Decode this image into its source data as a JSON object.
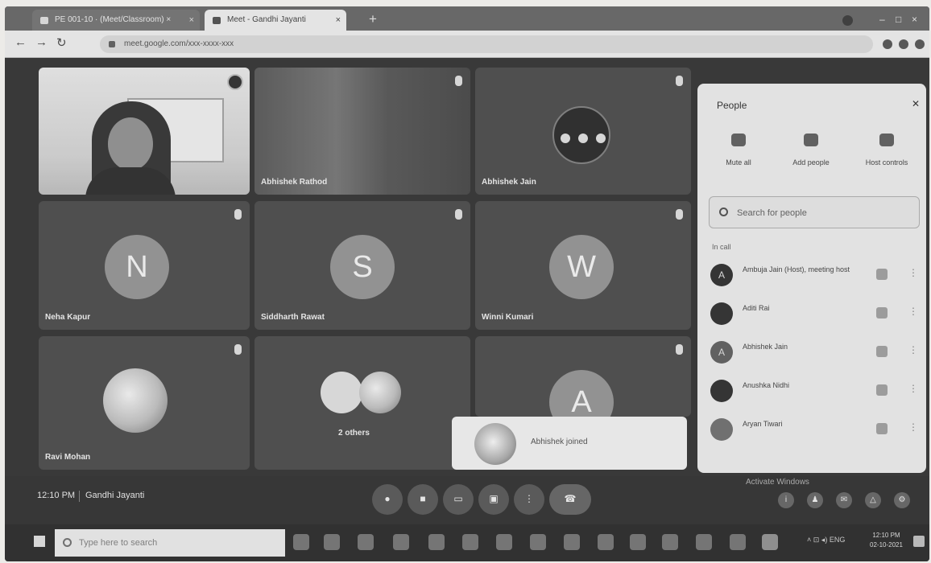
{
  "browser": {
    "tabs": [
      {
        "label": "PE 001-10 · (Meet/Classroom) ×"
      },
      {
        "label": "Meet - Gandhi Jayanti"
      }
    ],
    "new_tab_glyph": "+",
    "url": "meet.google.com/xxx-xxxx-xxx"
  },
  "meet": {
    "tiles": [
      {
        "name": "",
        "type": "video"
      },
      {
        "name": "Abhishek Rathod",
        "type": "blur"
      },
      {
        "name": "Abhishek Jain",
        "type": "self-controls"
      },
      {
        "name": "Neha Kapur",
        "type": "letter",
        "initial": "N"
      },
      {
        "name": "Siddharth Rawat",
        "type": "letter",
        "initial": "S"
      },
      {
        "name": "Winni Kumari",
        "type": "letter",
        "initial": "W"
      },
      {
        "name": "Ravi Mohan",
        "type": "picture"
      },
      {
        "name": "2 others",
        "type": "multi"
      },
      {
        "name": "",
        "type": "letter",
        "initial": "A"
      }
    ],
    "toast": "Abhishek joined"
  },
  "people": {
    "title": "People",
    "actions": [
      {
        "label": "Mute all",
        "icon": "mic-off-icon"
      },
      {
        "label": "Add people",
        "icon": "add-person-icon"
      },
      {
        "label": "Host controls",
        "icon": "shield-icon"
      }
    ],
    "search_placeholder": "Search for people",
    "section": "In call",
    "participants": [
      {
        "initial": "A",
        "name": "Ambuja Jain (Host), meeting host"
      },
      {
        "initial": "",
        "name": "Aditi Rai"
      },
      {
        "initial": "A",
        "name": "Abhishek Jain"
      },
      {
        "initial": "",
        "name": "Anushka Nidhi"
      },
      {
        "initial": "",
        "name": "Aryan Tiwari"
      }
    ]
  },
  "bottom": {
    "time": "12:10 PM",
    "meeting_title": "Gandhi Jayanti",
    "activate": "Activate Windows"
  },
  "taskbar": {
    "search_placeholder": "Type here to search",
    "clock": "12:10 PM",
    "date": "02-10-2021"
  }
}
